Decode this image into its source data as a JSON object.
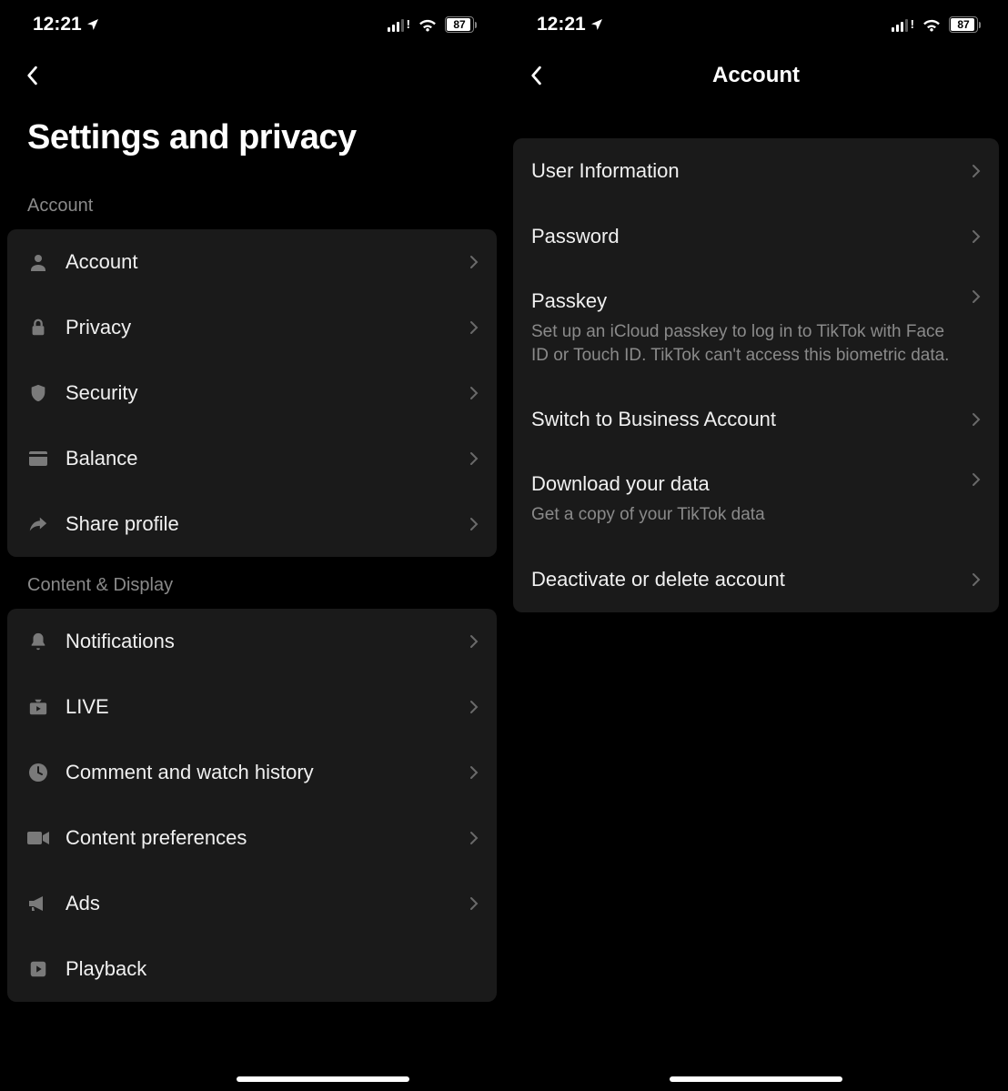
{
  "status": {
    "time": "12:21",
    "battery": "87"
  },
  "left": {
    "title": "Settings and privacy",
    "sections": [
      {
        "header": "Account",
        "items": [
          {
            "label": "Account"
          },
          {
            "label": "Privacy"
          },
          {
            "label": "Security"
          },
          {
            "label": "Balance"
          },
          {
            "label": "Share profile"
          }
        ]
      },
      {
        "header": "Content & Display",
        "items": [
          {
            "label": "Notifications"
          },
          {
            "label": "LIVE"
          },
          {
            "label": "Comment and watch history"
          },
          {
            "label": "Content preferences"
          },
          {
            "label": "Ads"
          },
          {
            "label": "Playback"
          }
        ]
      }
    ]
  },
  "right": {
    "navTitle": "Account",
    "items": [
      {
        "label": "User Information",
        "sub": ""
      },
      {
        "label": "Password",
        "sub": ""
      },
      {
        "label": "Passkey",
        "sub": "Set up an iCloud passkey to log in to TikTok with Face ID or Touch ID. TikTok can't access this biometric data."
      },
      {
        "label": "Switch to Business Account",
        "sub": ""
      },
      {
        "label": "Download your data",
        "sub": "Get a copy of your TikTok data"
      },
      {
        "label": "Deactivate or delete account",
        "sub": ""
      }
    ]
  }
}
